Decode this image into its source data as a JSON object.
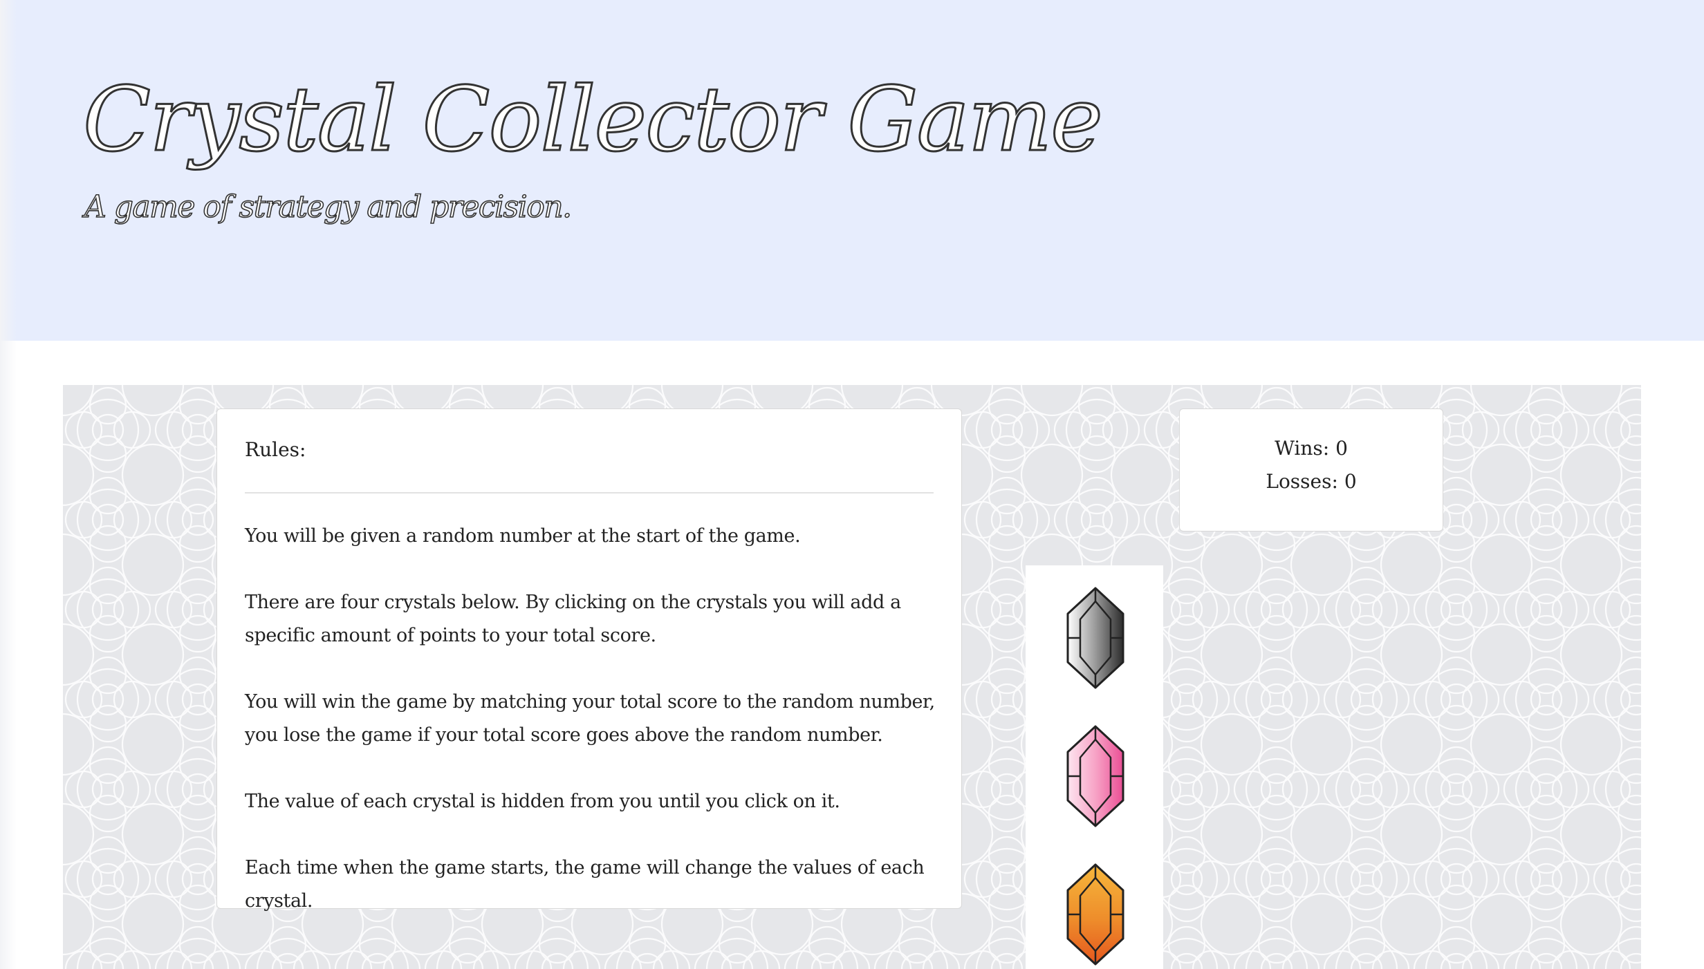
{
  "header": {
    "title": "Crystal Collector Game",
    "subtitle": "A game of strategy and precision."
  },
  "rules": {
    "heading": "Rules:",
    "paragraphs": [
      "You will be given a random number at the start of the game.",
      "There are four crystals below. By clicking on the crystals you will add a specific amount of points to your total score.",
      "You will win the game by matching your total score to the random number, you lose the game if your total score goes above the random number.",
      "The value of each crystal is hidden from you until you click on it.",
      "Each time when the game starts, the game will change the values of each crystal."
    ]
  },
  "score": {
    "wins": "Wins: 0",
    "losses": "Losses: 0"
  },
  "crystals": [
    {
      "name": "gray-crystal-icon",
      "color": "#6e6e6e"
    },
    {
      "name": "pink-crystal-icon",
      "color": "#f07fb0"
    },
    {
      "name": "orange-crystal-icon",
      "color": "#e8852a"
    }
  ],
  "colors": {
    "header_bg": "#e7edfd",
    "pattern_bg": "#e6e7ea",
    "card_bg": "#ffffff"
  }
}
